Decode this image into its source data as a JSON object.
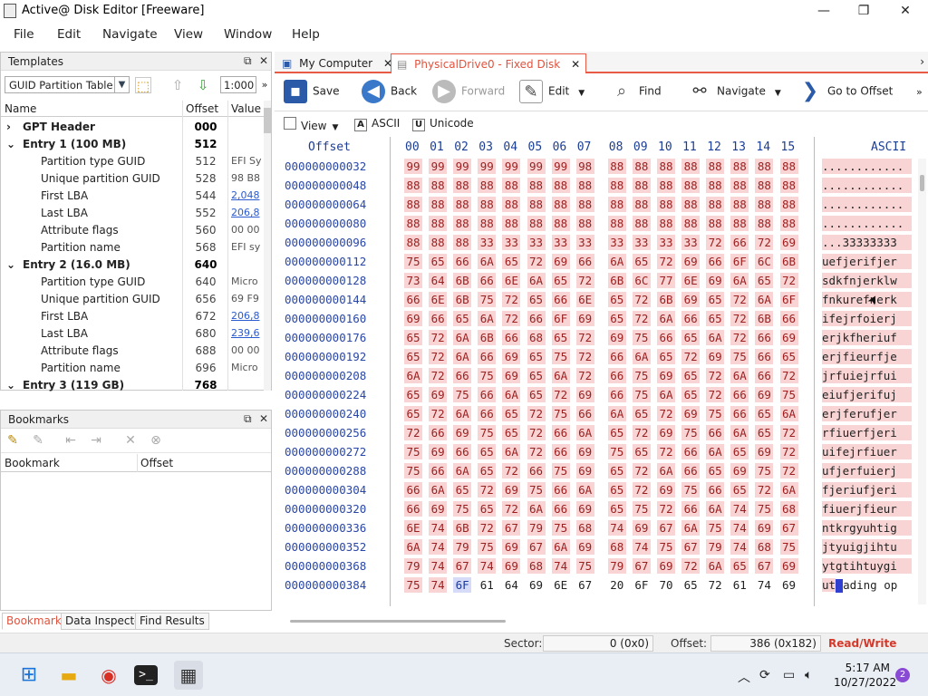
{
  "window": {
    "title": "Active@ Disk Editor [Freeware]",
    "minimize": "—",
    "maximize": "❐",
    "close": "✕"
  },
  "menu": [
    "File",
    "Edit",
    "Navigate",
    "View",
    "Window",
    "Help"
  ],
  "templates": {
    "title": "Templates",
    "combo_value": "GUID Partition Table",
    "zoom": "1:000",
    "columns": {
      "name": "Name",
      "offset": "Offset",
      "value": "Value"
    },
    "rows": [
      {
        "expander": "›",
        "name": "GPT Header",
        "offset": "000",
        "value": "",
        "group": true
      },
      {
        "expander": "⌄",
        "name": "Entry 1 (100 MB)",
        "offset": "512",
        "value": "",
        "group": true
      },
      {
        "expander": "",
        "name": "Partition type GUID",
        "offset": "512",
        "value": "EFI Sy",
        "group": false
      },
      {
        "expander": "",
        "name": "Unique partition GUID",
        "offset": "528",
        "value": "98 B8",
        "group": false
      },
      {
        "expander": "",
        "name": "First LBA",
        "offset": "544",
        "value": "2,048",
        "group": false,
        "link": true
      },
      {
        "expander": "",
        "name": "Last LBA",
        "offset": "552",
        "value": "206,8",
        "group": false,
        "link": true
      },
      {
        "expander": "",
        "name": "Attribute flags",
        "offset": "560",
        "value": "00 00",
        "group": false
      },
      {
        "expander": "",
        "name": "Partition name",
        "offset": "568",
        "value": "EFI sy",
        "group": false
      },
      {
        "expander": "⌄",
        "name": "Entry 2 (16.0 MB)",
        "offset": "640",
        "value": "",
        "group": true
      },
      {
        "expander": "",
        "name": "Partition type GUID",
        "offset": "640",
        "value": "Micro",
        "group": false
      },
      {
        "expander": "",
        "name": "Unique partition GUID",
        "offset": "656",
        "value": "69 F9",
        "group": false
      },
      {
        "expander": "",
        "name": "First LBA",
        "offset": "672",
        "value": "206,8",
        "group": false,
        "link": true
      },
      {
        "expander": "",
        "name": "Last LBA",
        "offset": "680",
        "value": "239,6",
        "group": false,
        "link": true
      },
      {
        "expander": "",
        "name": "Attribute flags",
        "offset": "688",
        "value": "00 00",
        "group": false
      },
      {
        "expander": "",
        "name": "Partition name",
        "offset": "696",
        "value": "Micro",
        "group": false
      },
      {
        "expander": "⌄",
        "name": "Entry 3 (119 GB)",
        "offset": "768",
        "value": "",
        "group": true
      }
    ]
  },
  "bookmarks": {
    "title": "Bookmarks",
    "columns": {
      "bookmark": "Bookmark",
      "offset": "Offset"
    }
  },
  "bottom_tabs": [
    "Bookmarks",
    "Data Inspector",
    "Find Results"
  ],
  "doc_tabs": [
    {
      "label": "My Computer"
    },
    {
      "label": "PhysicalDrive0 - Fixed Disk"
    }
  ],
  "toolbar": {
    "save": "Save",
    "back": "Back",
    "forward": "Forward",
    "edit": "Edit",
    "find": "Find",
    "navigate": "Navigate",
    "goto": "Go to Offset"
  },
  "viewbar": {
    "view": "View",
    "ascii": "ASCII",
    "unicode": "Unicode"
  },
  "hex": {
    "offset_header": "Offset",
    "ascii_header": "ASCII",
    "columns": [
      "00",
      "01",
      "02",
      "03",
      "04",
      "05",
      "06",
      "07",
      "08",
      "09",
      "10",
      "11",
      "12",
      "13",
      "14",
      "15"
    ],
    "rows": [
      {
        "offset": "000000000032",
        "bytes": [
          "99",
          "99",
          "99",
          "99",
          "99",
          "99",
          "99",
          "98",
          "88",
          "88",
          "88",
          "88",
          "88",
          "88",
          "88",
          "88"
        ],
        "ascii": "............"
      },
      {
        "offset": "000000000048",
        "bytes": [
          "88",
          "88",
          "88",
          "88",
          "88",
          "88",
          "88",
          "88",
          "88",
          "88",
          "88",
          "88",
          "88",
          "88",
          "88",
          "88"
        ],
        "ascii": "............"
      },
      {
        "offset": "000000000064",
        "bytes": [
          "88",
          "88",
          "88",
          "88",
          "88",
          "88",
          "88",
          "88",
          "88",
          "88",
          "88",
          "88",
          "88",
          "88",
          "88",
          "88"
        ],
        "ascii": "............"
      },
      {
        "offset": "000000000080",
        "bytes": [
          "88",
          "88",
          "88",
          "88",
          "88",
          "88",
          "88",
          "88",
          "88",
          "88",
          "88",
          "88",
          "88",
          "88",
          "88",
          "88"
        ],
        "ascii": "............"
      },
      {
        "offset": "000000000096",
        "bytes": [
          "88",
          "88",
          "88",
          "33",
          "33",
          "33",
          "33",
          "33",
          "33",
          "33",
          "33",
          "33",
          "72",
          "66",
          "72",
          "69"
        ],
        "ascii": "...33333333"
      },
      {
        "offset": "000000000112",
        "bytes": [
          "75",
          "65",
          "66",
          "6A",
          "65",
          "72",
          "69",
          "66",
          "6A",
          "65",
          "72",
          "69",
          "66",
          "6F",
          "6C",
          "6B"
        ],
        "ascii": "uefjerifjer"
      },
      {
        "offset": "000000000128",
        "bytes": [
          "73",
          "64",
          "6B",
          "66",
          "6E",
          "6A",
          "65",
          "72",
          "6B",
          "6C",
          "77",
          "6E",
          "69",
          "6A",
          "65",
          "72"
        ],
        "ascii": "sdkfnjerklw"
      },
      {
        "offset": "000000000144",
        "bytes": [
          "66",
          "6E",
          "6B",
          "75",
          "72",
          "65",
          "66",
          "6E",
          "65",
          "72",
          "6B",
          "69",
          "65",
          "72",
          "6A",
          "6F"
        ],
        "ascii": "fnkurefnerk"
      },
      {
        "offset": "000000000160",
        "bytes": [
          "69",
          "66",
          "65",
          "6A",
          "72",
          "66",
          "6F",
          "69",
          "65",
          "72",
          "6A",
          "66",
          "65",
          "72",
          "6B",
          "66"
        ],
        "ascii": "ifejrfoierj"
      },
      {
        "offset": "000000000176",
        "bytes": [
          "65",
          "72",
          "6A",
          "6B",
          "66",
          "68",
          "65",
          "72",
          "69",
          "75",
          "66",
          "65",
          "6A",
          "72",
          "66",
          "69"
        ],
        "ascii": "erjkfheriuf"
      },
      {
        "offset": "000000000192",
        "bytes": [
          "65",
          "72",
          "6A",
          "66",
          "69",
          "65",
          "75",
          "72",
          "66",
          "6A",
          "65",
          "72",
          "69",
          "75",
          "66",
          "65"
        ],
        "ascii": "erjfieurfje"
      },
      {
        "offset": "000000000208",
        "bytes": [
          "6A",
          "72",
          "66",
          "75",
          "69",
          "65",
          "6A",
          "72",
          "66",
          "75",
          "69",
          "65",
          "72",
          "6A",
          "66",
          "72"
        ],
        "ascii": "jrfuiejrfui"
      },
      {
        "offset": "000000000224",
        "bytes": [
          "65",
          "69",
          "75",
          "66",
          "6A",
          "65",
          "72",
          "69",
          "66",
          "75",
          "6A",
          "65",
          "72",
          "66",
          "69",
          "75"
        ],
        "ascii": "eiufjerifuj"
      },
      {
        "offset": "000000000240",
        "bytes": [
          "65",
          "72",
          "6A",
          "66",
          "65",
          "72",
          "75",
          "66",
          "6A",
          "65",
          "72",
          "69",
          "75",
          "66",
          "65",
          "6A"
        ],
        "ascii": "erjferufjer"
      },
      {
        "offset": "000000000256",
        "bytes": [
          "72",
          "66",
          "69",
          "75",
          "65",
          "72",
          "66",
          "6A",
          "65",
          "72",
          "69",
          "75",
          "66",
          "6A",
          "65",
          "72"
        ],
        "ascii": "rfiuerfjeri"
      },
      {
        "offset": "000000000272",
        "bytes": [
          "75",
          "69",
          "66",
          "65",
          "6A",
          "72",
          "66",
          "69",
          "75",
          "65",
          "72",
          "66",
          "6A",
          "65",
          "69",
          "72"
        ],
        "ascii": "uifejrfiuer"
      },
      {
        "offset": "000000000288",
        "bytes": [
          "75",
          "66",
          "6A",
          "65",
          "72",
          "66",
          "75",
          "69",
          "65",
          "72",
          "6A",
          "66",
          "65",
          "69",
          "75",
          "72"
        ],
        "ascii": "ufjerfuierj"
      },
      {
        "offset": "000000000304",
        "bytes": [
          "66",
          "6A",
          "65",
          "72",
          "69",
          "75",
          "66",
          "6A",
          "65",
          "72",
          "69",
          "75",
          "66",
          "65",
          "72",
          "6A"
        ],
        "ascii": "fjeriufjeri"
      },
      {
        "offset": "000000000320",
        "bytes": [
          "66",
          "69",
          "75",
          "65",
          "72",
          "6A",
          "66",
          "69",
          "65",
          "75",
          "72",
          "66",
          "6A",
          "74",
          "75",
          "68"
        ],
        "ascii": "fiuerjfieur"
      },
      {
        "offset": "000000000336",
        "bytes": [
          "6E",
          "74",
          "6B",
          "72",
          "67",
          "79",
          "75",
          "68",
          "74",
          "69",
          "67",
          "6A",
          "75",
          "74",
          "69",
          "67"
        ],
        "ascii": "ntkrgyuhtig"
      },
      {
        "offset": "000000000352",
        "bytes": [
          "6A",
          "74",
          "79",
          "75",
          "69",
          "67",
          "6A",
          "69",
          "68",
          "74",
          "75",
          "67",
          "79",
          "74",
          "68",
          "75"
        ],
        "ascii": "jtyuigjihtu"
      },
      {
        "offset": "000000000368",
        "bytes": [
          "79",
          "74",
          "67",
          "74",
          "69",
          "68",
          "74",
          "75",
          "79",
          "67",
          "69",
          "72",
          "6A",
          "65",
          "67",
          "69"
        ],
        "ascii": "ytgtihtuygi"
      },
      {
        "offset": "000000000384",
        "bytes": [
          "75",
          "74",
          "6F",
          "61",
          "64",
          "69",
          "6E",
          "67",
          "20",
          "6F",
          "70",
          "65",
          "72",
          "61",
          "74",
          "69"
        ],
        "ascii_pre": "ut",
        "ascii_post": "ading op"
      }
    ]
  },
  "status": {
    "sector_label": "Sector:",
    "sector_value": "0 (0x0)",
    "offset_label": "Offset:",
    "offset_value": "386 (0x182)",
    "mode": "Read/Write"
  },
  "taskbar": {
    "time": "5:17 AM",
    "date": "10/27/2022",
    "notifications": "2"
  }
}
